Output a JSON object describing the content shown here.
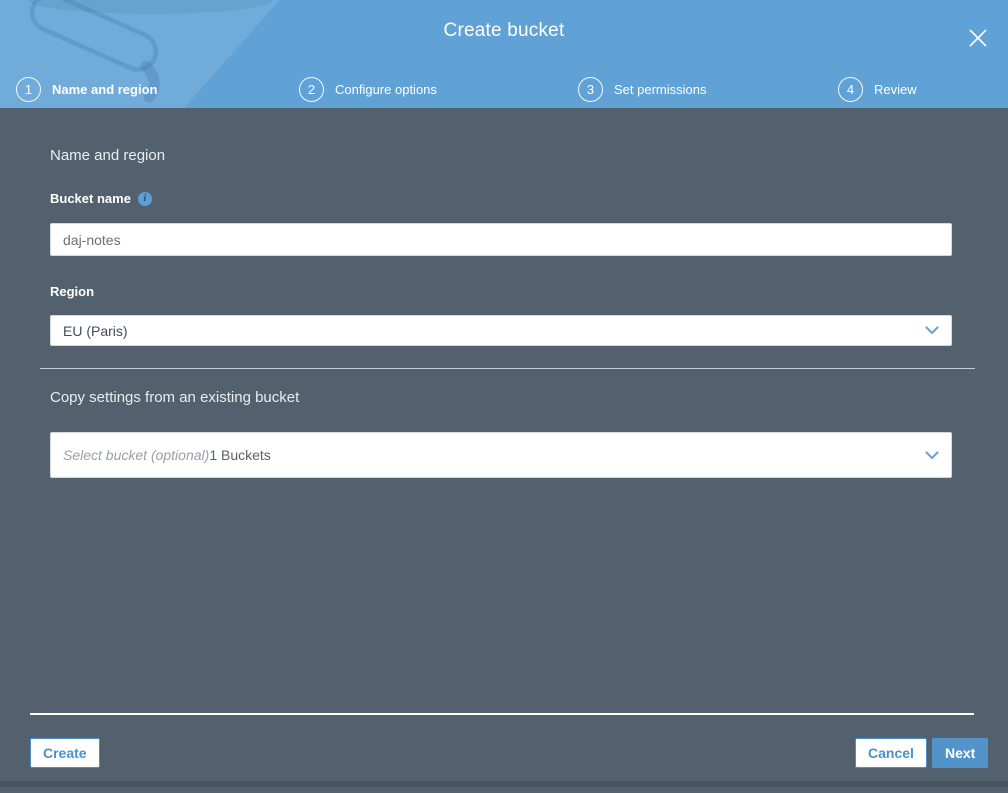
{
  "modal": {
    "title": "Create bucket"
  },
  "steps": [
    {
      "number": "1",
      "label": "Name and region",
      "active": true
    },
    {
      "number": "2",
      "label": "Configure options",
      "active": false
    },
    {
      "number": "3",
      "label": "Set permissions",
      "active": false
    },
    {
      "number": "4",
      "label": "Review",
      "active": false
    }
  ],
  "form": {
    "section_heading": "Name and region",
    "bucket_name_label": "Bucket name",
    "info_icon_glyph": "i",
    "bucket_name_value": "daj-notes",
    "region_label": "Region",
    "region_value": "EU (Paris)",
    "copy_settings_heading": "Copy settings from an existing bucket",
    "copy_bucket_placeholder": "Select bucket (optional)",
    "copy_bucket_suffix": "1 Buckets"
  },
  "footer": {
    "create_label": "Create",
    "cancel_label": "Cancel",
    "next_label": "Next"
  },
  "colors": {
    "header_blue": "#60A2D5",
    "body_background": "#53616F",
    "accent_blue": "#4D90C9",
    "next_button_blue": "#5294C9",
    "info_icon_blue": "#5C9FD6",
    "divider_light": "#C9CED3",
    "bottom_strip": "#47535F"
  }
}
